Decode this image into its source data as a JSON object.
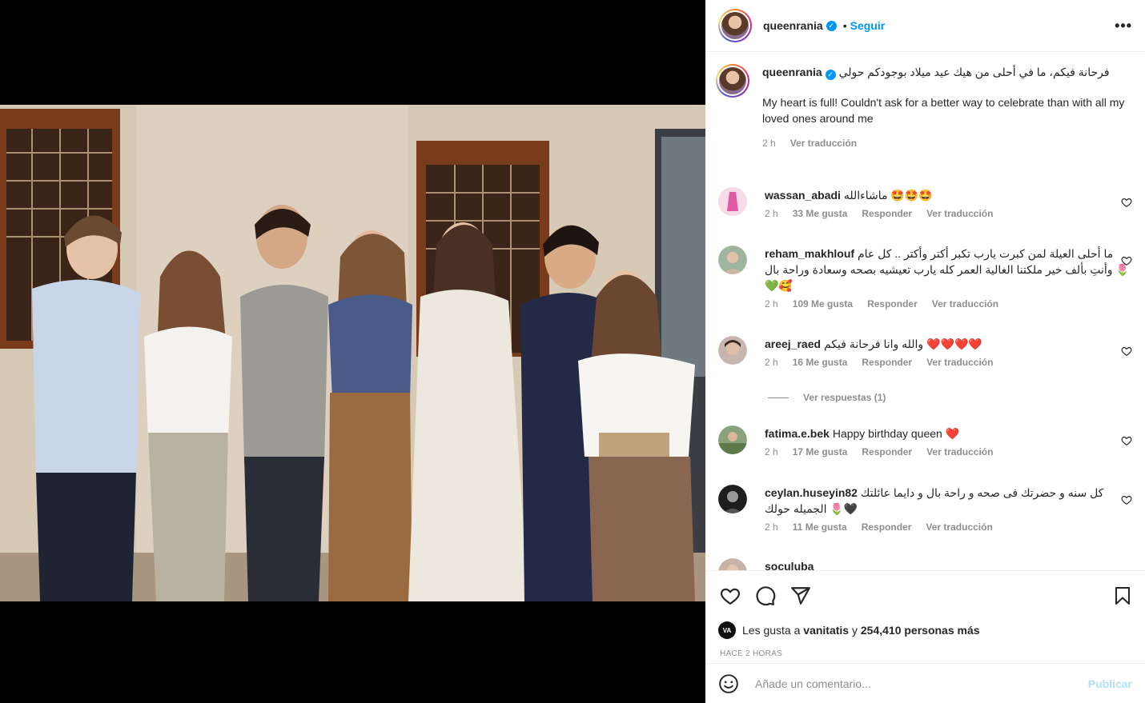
{
  "post": {
    "username": "queenrania",
    "follow_label": "Seguir",
    "dot": "•",
    "more": "•••"
  },
  "caption": {
    "username": "queenrania",
    "text_ar": "فرحانة فيكم، ما في أحلى من هيك عيد ميلاد بوجودكم حولي",
    "text_en": "My heart is full! Couldn't ask for a better way to celebrate than with all my loved ones around me",
    "time": "2 h",
    "translate": "Ver traducción"
  },
  "comments": [
    {
      "username": "wassan_abadi",
      "text": "ماشاءالله 🤩🤩🤩",
      "time": "2 h",
      "likes": "33 Me gusta",
      "reply": "Responder",
      "translate": "Ver traducción"
    },
    {
      "username": "reham_makhlouf",
      "text": "ما أحلى العيلة لمن كبرت يارب تكبر أكتر وأكتر .. كل عام وأنتِ بألف خير ملكتنا الغالية العمر كله يارب تعيشيه بصحه وسعادة وراحة بال 🌷💚🥰",
      "time": "2 h",
      "likes": "109 Me gusta",
      "reply": "Responder",
      "translate": "Ver traducción"
    },
    {
      "username": "areej_raed",
      "text": "والله وانا فرحانة فيكم ❤️❤️❤️❤️",
      "time": "2 h",
      "likes": "16 Me gusta",
      "reply": "Responder",
      "translate": "Ver traducción"
    },
    {
      "username": "fatima.e.bek",
      "text": "Happy birthday queen ❤️",
      "time": "2 h",
      "likes": "17 Me gusta",
      "reply": "Responder",
      "translate": "Ver traducción"
    },
    {
      "username": "ceylan.huseyin82",
      "text": "كل سنه و حضرتك فى صحه و راحة بال و دايما عائلتك الجميله حولك 🌷🖤",
      "time": "2 h",
      "likes": "11 Me gusta",
      "reply": "Responder",
      "translate": "Ver traducción"
    },
    {
      "username": "soculuba",
      "text": "",
      "time": "",
      "likes": "",
      "reply": "",
      "translate": ""
    }
  ],
  "view_replies": "Ver respuestas (1)",
  "likes": {
    "avatar_text": "VA",
    "prefix": "Les gusta a",
    "user": "vanitatis",
    "conj": "y",
    "rest": "254,410 personas más"
  },
  "time_ago": "HACE 2 HORAS",
  "add_comment": {
    "placeholder": "Añade un comentario...",
    "publish": "Publicar"
  },
  "icons": {
    "like": "heart-icon",
    "comment": "comment-icon",
    "share": "send-icon",
    "save": "bookmark-icon",
    "emoji": "emoji-icon"
  },
  "colors": {
    "link": "#0095f6",
    "secondary": "#8e8e8e",
    "publish_disabled": "#b2dffc"
  }
}
